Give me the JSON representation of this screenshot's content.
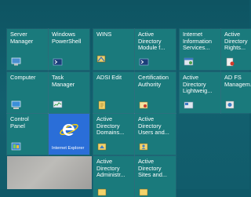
{
  "screen": "Start",
  "colors": {
    "background": "#0f5968",
    "tile": "#1a7a7c",
    "ie_tile": "#2a6ed8"
  },
  "tiles": [
    {
      "label": "Server\nManager",
      "icon": "server-manager-icon"
    },
    {
      "label": "Windows\nPowerShell",
      "icon": "powershell-icon"
    },
    {
      "label": "WINS",
      "icon": "wins-icon"
    },
    {
      "label": "Active\nDirectory\nModule f...",
      "icon": "ad-module-icon"
    },
    {
      "label": "Internet\nInformation\nServices...",
      "icon": "iis-icon"
    },
    {
      "label": "Active\nDirectory\nRights...",
      "icon": "ad-rights-icon"
    },
    {
      "label": "Computer",
      "icon": "computer-icon"
    },
    {
      "label": "Task\nManager",
      "icon": "task-manager-icon"
    },
    {
      "label": "ADSI Edit",
      "icon": "adsi-edit-icon"
    },
    {
      "label": "Certification\nAuthority",
      "icon": "certification-authority-icon"
    },
    {
      "label": "Active\nDirectory\nLightweig...",
      "icon": "ad-lightweight-icon"
    },
    {
      "label": "AD FS\nManagem...",
      "icon": "adfs-icon"
    },
    {
      "label": "Control\nPanel",
      "icon": "control-panel-icon"
    },
    {
      "label": "Internet Explorer",
      "icon": "internet-explorer-icon"
    },
    {
      "label": "Active\nDirectory\nDomains...",
      "icon": "ad-domains-icon"
    },
    {
      "label": "Active\nDirectory\nUsers and...",
      "icon": "ad-users-icon"
    },
    {
      "label": "Active\nDirectory\nAdministr...",
      "icon": "ad-admin-center-icon"
    },
    {
      "label": "Active\nDirectory\nSites and...",
      "icon": "ad-sites-icon"
    }
  ]
}
